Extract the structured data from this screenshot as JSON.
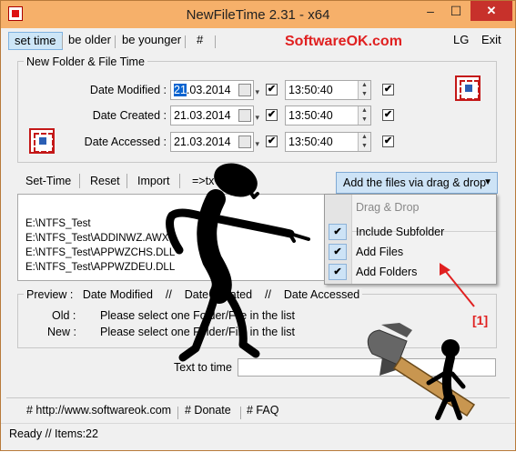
{
  "window": {
    "title": "NewFileTime 2.31 - x64",
    "minimize_glyph": "–",
    "maximize_glyph": "☐",
    "close_glyph": "✕"
  },
  "menu": {
    "items": [
      "set time",
      "be older",
      "be younger",
      "#"
    ],
    "lg": "LG",
    "exit": "Exit"
  },
  "brand": {
    "text": "SoftwareOK.com"
  },
  "group": {
    "title": "New Folder & File Time",
    "rows": [
      {
        "label": "Date Modified :",
        "date": "21.03.2014",
        "date_highlight": "21",
        "date_rest": ".03.2014",
        "time": "13:50:40",
        "date_checked": true,
        "time_checked": true
      },
      {
        "label": "Date Created :",
        "date": "21.03.2014",
        "time": "13:50:40",
        "date_checked": true,
        "time_checked": true
      },
      {
        "label": "Date Accessed :",
        "date": "21.03.2014",
        "time": "13:50:40",
        "date_checked": true,
        "time_checked": true
      }
    ]
  },
  "toolbar": {
    "set_time": "Set-Time",
    "reset": "Reset",
    "import": "Import",
    "export": "=>tx",
    "drag_button": "Add the files via drag & drop"
  },
  "filelist": {
    "items": [
      "E:\\NTFS_Test",
      "E:\\NTFS_Test\\ADDINWZ.AWX",
      "E:\\NTFS_Test\\APPWZCHS.DLL",
      "E:\\NTFS_Test\\APPWZDEU.DLL"
    ]
  },
  "dropmenu": {
    "header": "Drag & Drop",
    "items": [
      {
        "label": "Include Subfolder",
        "checked": true
      },
      {
        "label": "Add Files",
        "checked": true
      },
      {
        "label": "Add Folders",
        "checked": true
      }
    ]
  },
  "preview": {
    "label": "Preview :",
    "modified": "Date Modified",
    "sep1": "//",
    "created": "Date Created",
    "sep2": "//",
    "accessed": "Date Accessed",
    "old_label": "Old :",
    "old_text": "Please select one Folder/File in the list",
    "new_label": "New :",
    "new_text": "Please select one Folder/File in the list"
  },
  "text_to_time": {
    "label": "Text to time",
    "value": ""
  },
  "footer": {
    "link1": "# http://www.softwareok.com",
    "link2": "# Donate",
    "link3": "# FAQ"
  },
  "status": {
    "text": "Ready // Items:22"
  },
  "annotation": {
    "text": "[1]"
  },
  "colors": {
    "titlebar": "#f6b06a",
    "close": "#c7312b",
    "brand": "#e02020",
    "accent": "#cde3f6"
  }
}
